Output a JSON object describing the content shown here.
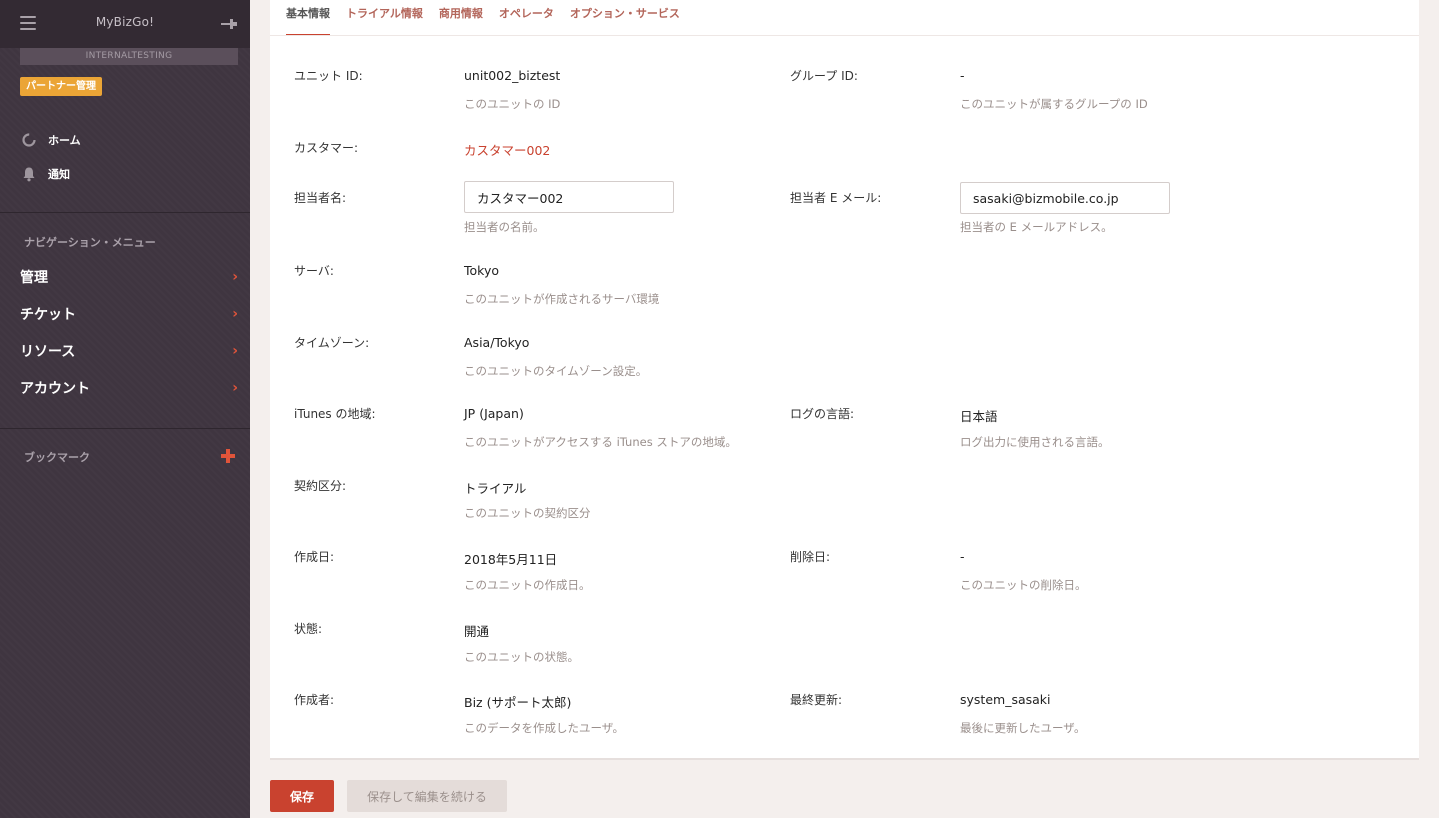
{
  "sidebar": {
    "app_title": "MyBizGo!",
    "environment": "INTERNALTESTING",
    "partner_badge": "パートナー管理",
    "links": [
      {
        "label": "ホーム",
        "icon": "circle-loading-icon"
      },
      {
        "label": "通知",
        "icon": "bell-icon"
      }
    ],
    "nav_header": "ナビゲーション・メニュー",
    "nav_items": [
      {
        "label": "管理"
      },
      {
        "label": "チケット"
      },
      {
        "label": "リソース"
      },
      {
        "label": "アカウント"
      }
    ],
    "bookmark_label": "ブックマーク"
  },
  "tabs": [
    {
      "label": "基本情報",
      "active": true
    },
    {
      "label": "トライアル情報",
      "active": false
    },
    {
      "label": "商用情報",
      "active": false
    },
    {
      "label": "オペレータ",
      "active": false
    },
    {
      "label": "オプション・サービス",
      "active": false
    }
  ],
  "fields": {
    "unit_id": {
      "label": "ユニット ID:",
      "value": "unit002_biztest",
      "help": "このユニットの ID"
    },
    "group_id": {
      "label": "グループ ID:",
      "value": "-",
      "help": "このユニットが属するグループの ID"
    },
    "customer": {
      "label": "カスタマー:",
      "value": "カスタマー002"
    },
    "contact_name": {
      "label": "担当者名:",
      "value": "カスタマー002",
      "help": "担当者の名前。"
    },
    "contact_email": {
      "label": "担当者 E メール:",
      "value": "sasaki@bizmobile.co.jp",
      "help": "担当者の E メールアドレス。"
    },
    "server": {
      "label": "サーバ:",
      "value": "Tokyo",
      "help": "このユニットが作成されるサーバ環境"
    },
    "timezone": {
      "label": "タイムゾーン:",
      "value": "Asia/Tokyo",
      "help": "このユニットのタイムゾーン設定。"
    },
    "itunes_region": {
      "label": "iTunes の地域:",
      "value": "JP (Japan)",
      "help": "このユニットがアクセスする iTunes ストアの地域。"
    },
    "log_language": {
      "label": "ログの言語:",
      "value": "日本語",
      "help": "ログ出力に使用される言語。"
    },
    "contract_type": {
      "label": "契約区分:",
      "value": "トライアル",
      "help": "このユニットの契約区分"
    },
    "created_date": {
      "label": "作成日:",
      "value": "2018年5月11日",
      "help": "このユニットの作成日。"
    },
    "deleted_date": {
      "label": "削除日:",
      "value": "-",
      "help": "このユニットの削除日。"
    },
    "status": {
      "label": "状態:",
      "value": "開通",
      "help": "このユニットの状態。"
    },
    "creator": {
      "label": "作成者:",
      "value": "Biz (サポート太郎)",
      "help": "このデータを作成したユーザ。"
    },
    "last_updated": {
      "label": "最終更新:",
      "value": "system_sasaki",
      "help": "最後に更新したユーザ。"
    }
  },
  "buttons": {
    "save": "保存",
    "save_continue": "保存して編集を続ける"
  },
  "colors": {
    "sidebar_bg": "#3f3540",
    "accent": "#c9422f",
    "badge": "#eba536"
  }
}
